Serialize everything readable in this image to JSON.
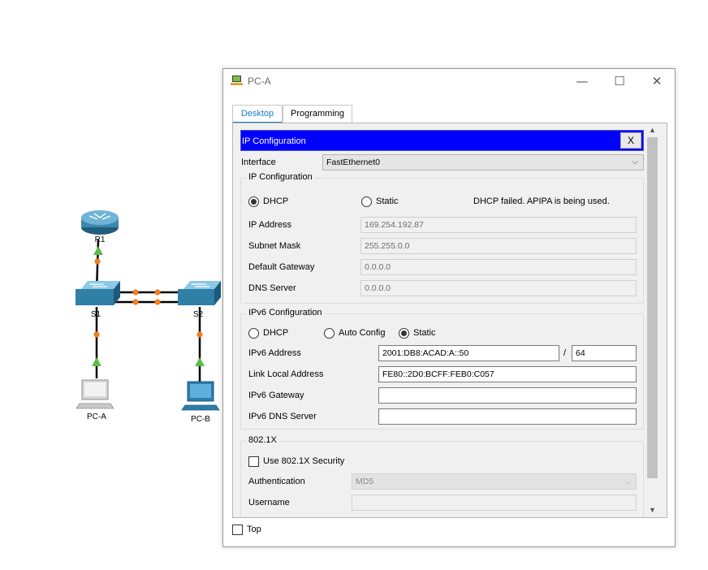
{
  "topology": {
    "devices": {
      "r1": "R1",
      "s1": "S1",
      "s2": "S2",
      "pca": "PC-A",
      "pcb": "PC-B"
    },
    "colors": {
      "link": "#000000",
      "port_dot": "#f07d20",
      "up_arrow": "#5dbb46",
      "device": "#2f7fa6"
    }
  },
  "window": {
    "title": "PC-A",
    "controls": {
      "minimize": "—",
      "maximize": "☐",
      "close": "✕"
    },
    "tabs": [
      {
        "label": "Desktop",
        "active": true
      },
      {
        "label": "Programming",
        "active": false
      }
    ]
  },
  "ip_config": {
    "header": "IP Configuration",
    "close_label": "X",
    "interface_label": "Interface",
    "interface_value": "FastEthernet0",
    "ipv4": {
      "group_title": "IP Configuration",
      "dhcp_label": "DHCP",
      "static_label": "Static",
      "mode": "DHCP",
      "status": "DHCP failed. APIPA is being used.",
      "fields": [
        {
          "label": "IP Address",
          "value": "169.254.192.87"
        },
        {
          "label": "Subnet Mask",
          "value": "255.255.0.0"
        },
        {
          "label": "Default Gateway",
          "value": "0.0.0.0"
        },
        {
          "label": "DNS Server",
          "value": "0.0.0.0"
        }
      ]
    },
    "ipv6": {
      "group_title": "IPv6 Configuration",
      "dhcp_label": "DHCP",
      "auto_label": "Auto Config",
      "static_label": "Static",
      "mode": "Static",
      "address_label": "IPv6 Address",
      "address_value": "2001:DB8:ACAD:A::50",
      "prefix_sep": "/",
      "prefix_value": "64",
      "link_local_label": "Link Local Address",
      "link_local_value": "FE80::2D0:BCFF:FEB0:C057",
      "gateway_label": "IPv6 Gateway",
      "gateway_value": "",
      "dns_label": "IPv6 DNS Server",
      "dns_value": ""
    },
    "dot1x": {
      "group_title": "802.1X",
      "use_label": "Use 802.1X Security",
      "checked": false,
      "auth_label": "Authentication",
      "auth_value": "MD5",
      "username_label": "Username",
      "username_value": ""
    }
  },
  "footer": {
    "top_label": "Top",
    "top_checked": false
  }
}
